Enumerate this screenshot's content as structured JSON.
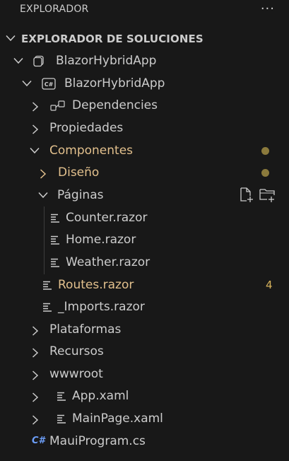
{
  "header": {
    "title": "EXPLORADOR",
    "more_label": "···"
  },
  "section": {
    "title": "EXPLORADOR DE SOLUCIONES"
  },
  "tree": {
    "solution": {
      "label": "BlazorHybridApp"
    },
    "project": {
      "label": "BlazorHybridApp",
      "icon_text": "C#"
    },
    "dependencies": {
      "label": "Dependencies"
    },
    "propiedades": {
      "label": "Propiedades"
    },
    "componentes": {
      "label": "Componentes"
    },
    "diseno": {
      "label": "Diseño"
    },
    "paginas": {
      "label": "Páginas"
    },
    "counter": {
      "label": "Counter.razor"
    },
    "home": {
      "label": "Home.razor"
    },
    "weather": {
      "label": "Weather.razor"
    },
    "routes": {
      "label": "Routes.razor",
      "badge": "4"
    },
    "imports": {
      "label": "_Imports.razor"
    },
    "plataformas": {
      "label": "Plataformas"
    },
    "recursos": {
      "label": "Recursos"
    },
    "wwwroot": {
      "label": "wwwroot"
    },
    "appxaml": {
      "label": "App.xaml"
    },
    "mainpage": {
      "label": "MainPage.xaml"
    },
    "mauiprogram": {
      "label": "MauiProgram.cs",
      "icon_text": "C#"
    }
  },
  "colors": {
    "background": "#181818",
    "text": "#cccccc",
    "modified": "#e2c08d",
    "dot": "#8b7a3c",
    "badge": "#d7b35c",
    "csharp": "#6c9ef8"
  }
}
